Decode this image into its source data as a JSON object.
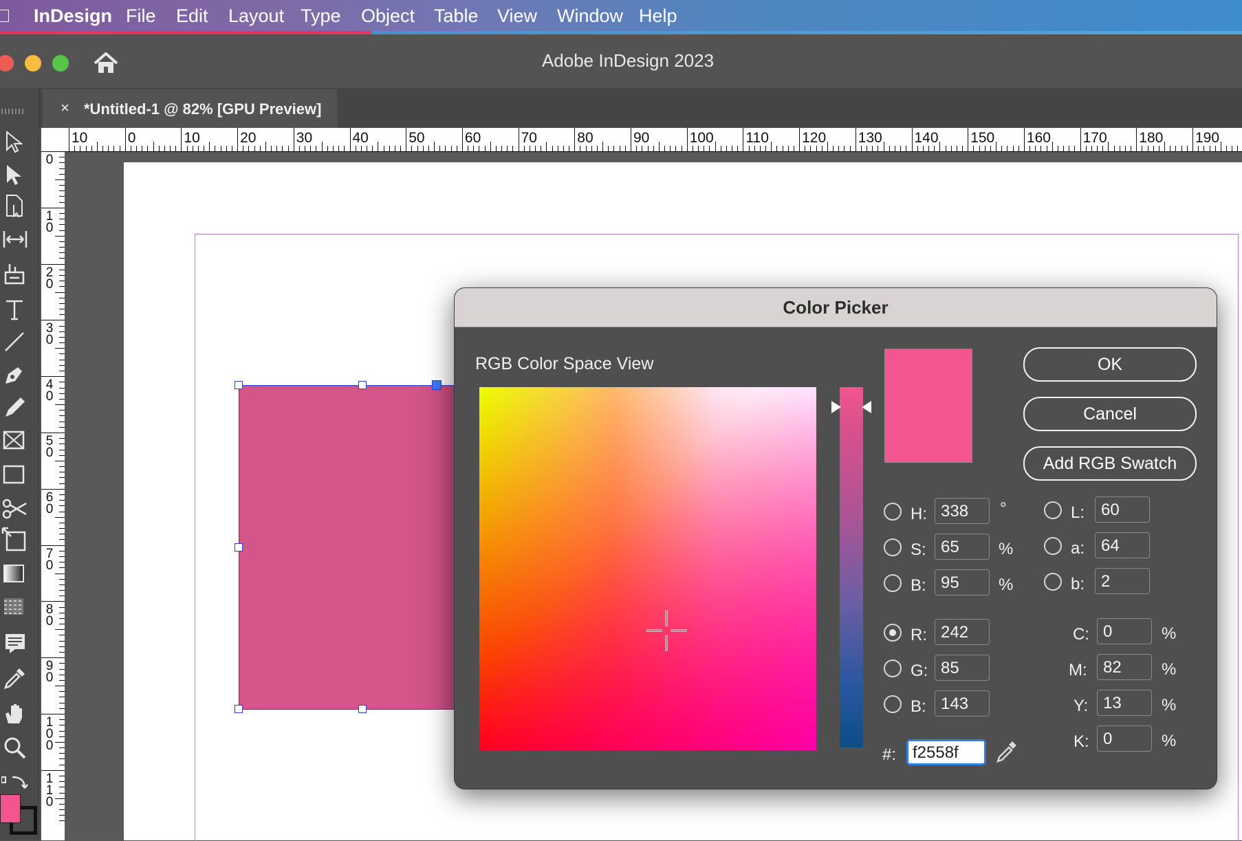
{
  "menubar": {
    "app": "InDesign",
    "items": [
      "File",
      "Edit",
      "Layout",
      "Type",
      "Object",
      "Table",
      "View",
      "Window",
      "Help"
    ]
  },
  "window": {
    "title": "Adobe InDesign 2023"
  },
  "document_tab": {
    "close": "×",
    "label": "*Untitled-1 @ 82% [GPU Preview]"
  },
  "ruler": {
    "horizontal": [
      "10",
      "0",
      "10",
      "20",
      "30",
      "40",
      "50",
      "60",
      "70",
      "80",
      "90",
      "100",
      "110",
      "120",
      "130",
      "140",
      "150",
      "160",
      "170",
      "180",
      "190"
    ],
    "vertical": [
      "0",
      "1 0",
      "2 0",
      "3 0",
      "4 0",
      "5 0",
      "6 0",
      "7 0",
      "8 0",
      "9 0",
      "1 0 0",
      "1 1 0"
    ]
  },
  "toolbar": {
    "tools": [
      "selection-tool",
      "direct-selection-tool",
      "page-tool",
      "gap-tool",
      "content-collector-tool",
      "type-tool",
      "line-tool",
      "pen-tool",
      "pencil-tool",
      "rectangle-frame-tool",
      "rectangle-tool",
      "scissors-tool",
      "free-transform-tool",
      "gradient-swatch-tool",
      "gradient-feather-tool",
      "note-tool",
      "eyedropper-tool",
      "hand-tool",
      "zoom-tool"
    ],
    "fill_color": "#f2558f"
  },
  "dialog": {
    "title": "Color Picker",
    "space_label": "RGB Color Space View",
    "buttons": {
      "ok": "OK",
      "cancel": "Cancel",
      "add_swatch": "Add RGB Swatch"
    },
    "hsb": {
      "h": {
        "label": "H:",
        "value": "338",
        "unit": "°"
      },
      "s": {
        "label": "S:",
        "value": "65",
        "unit": "%"
      },
      "b": {
        "label": "B:",
        "value": "95",
        "unit": "%"
      }
    },
    "lab": {
      "l": {
        "label": "L:",
        "value": "60"
      },
      "a": {
        "label": "a:",
        "value": "64"
      },
      "b": {
        "label": "b:",
        "value": "2"
      }
    },
    "rgb": {
      "r": {
        "label": "R:",
        "value": "242",
        "selected": true
      },
      "g": {
        "label": "G:",
        "value": "85"
      },
      "b": {
        "label": "B:",
        "value": "143"
      }
    },
    "cmyk": {
      "c": {
        "label": "C:",
        "value": "0",
        "unit": "%"
      },
      "m": {
        "label": "M:",
        "value": "82",
        "unit": "%"
      },
      "y": {
        "label": "Y:",
        "value": "13",
        "unit": "%"
      },
      "k": {
        "label": "K:",
        "value": "0",
        "unit": "%"
      }
    },
    "hex": {
      "label": "#:",
      "value": "f2558f"
    },
    "preview_color": "#f2558f"
  }
}
